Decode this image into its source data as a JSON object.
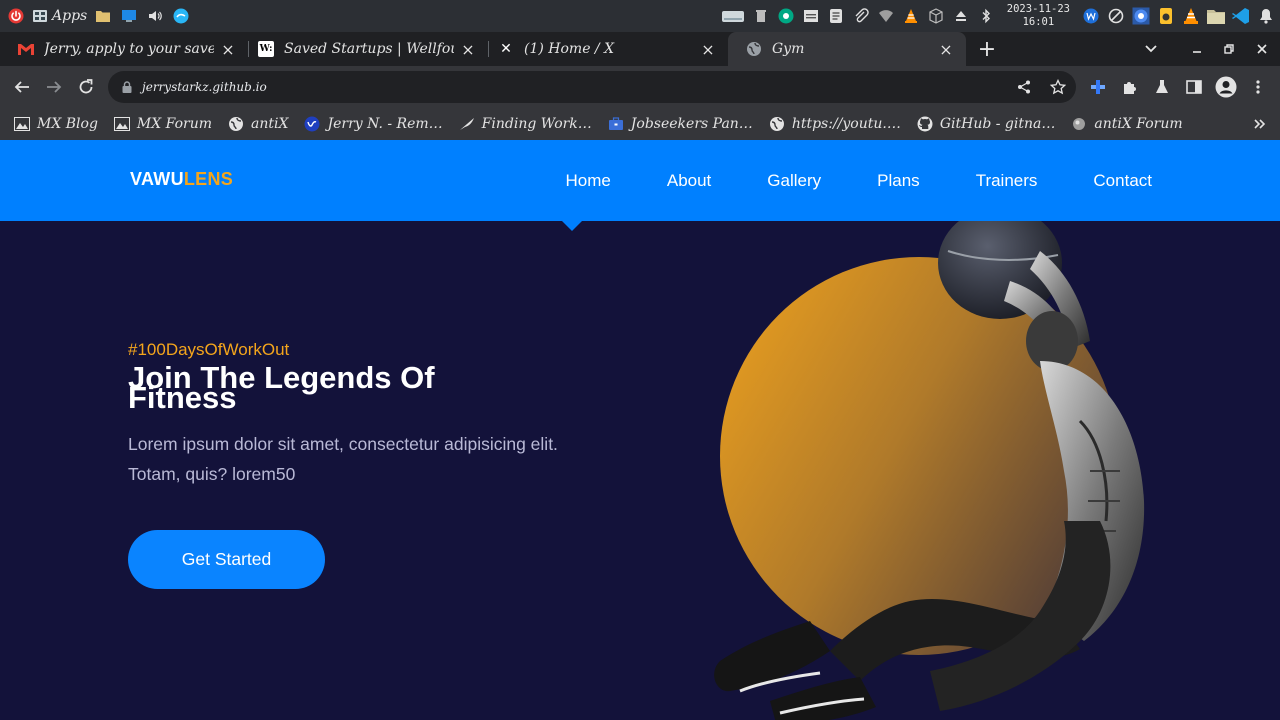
{
  "taskbar": {
    "apps_label": "Apps",
    "clock_date": "2023-11-23",
    "clock_time": "16:01"
  },
  "tabs": [
    {
      "title": "Jerry, apply to your saved j",
      "favicon": "gmail-icon",
      "active": false
    },
    {
      "title": "Saved Startups | Wellfound",
      "favicon": "wellfound-icon",
      "active": false
    },
    {
      "title": "(1) Home / X",
      "favicon": "x-icon",
      "active": false
    },
    {
      "title": "Gym",
      "favicon": "globe-icon",
      "active": true
    }
  ],
  "toolbar": {
    "url": "jerrystarkz.github.io"
  },
  "bookmarks": [
    {
      "label": "MX Blog",
      "icon": "mx-icon"
    },
    {
      "label": "MX Forum",
      "icon": "mx-icon"
    },
    {
      "label": "antiX",
      "icon": "globe-icon"
    },
    {
      "label": "Jerry N. - Rem…",
      "icon": "upwork-icon"
    },
    {
      "label": "Finding Work…",
      "icon": "feather-icon"
    },
    {
      "label": "Jobseekers Pan…",
      "icon": "briefcase-icon"
    },
    {
      "label": "https://youtu.…",
      "icon": "globe-icon"
    },
    {
      "label": "GitHub - gitna…",
      "icon": "github-icon"
    },
    {
      "label": "antiX Forum",
      "icon": "antix-icon"
    }
  ],
  "site": {
    "logo_part1": "VAWU",
    "logo_part2": "LENS",
    "nav": [
      "Home",
      "About",
      "Gallery",
      "Plans",
      "Trainers",
      "Contact"
    ],
    "hero_sub": "#100DaysOfWorkOut",
    "hero_title": "Join The Legends Of Fitness",
    "hero_text": "Lorem ipsum dolor sit amet, consectetur adipisicing elit. Totam, quis? lorem50",
    "cta": "Get Started"
  },
  "colors": {
    "nav_bg": "#0080ff",
    "page_bg": "#13123a",
    "accent": "#f4a51c",
    "button": "#0a84ff"
  }
}
